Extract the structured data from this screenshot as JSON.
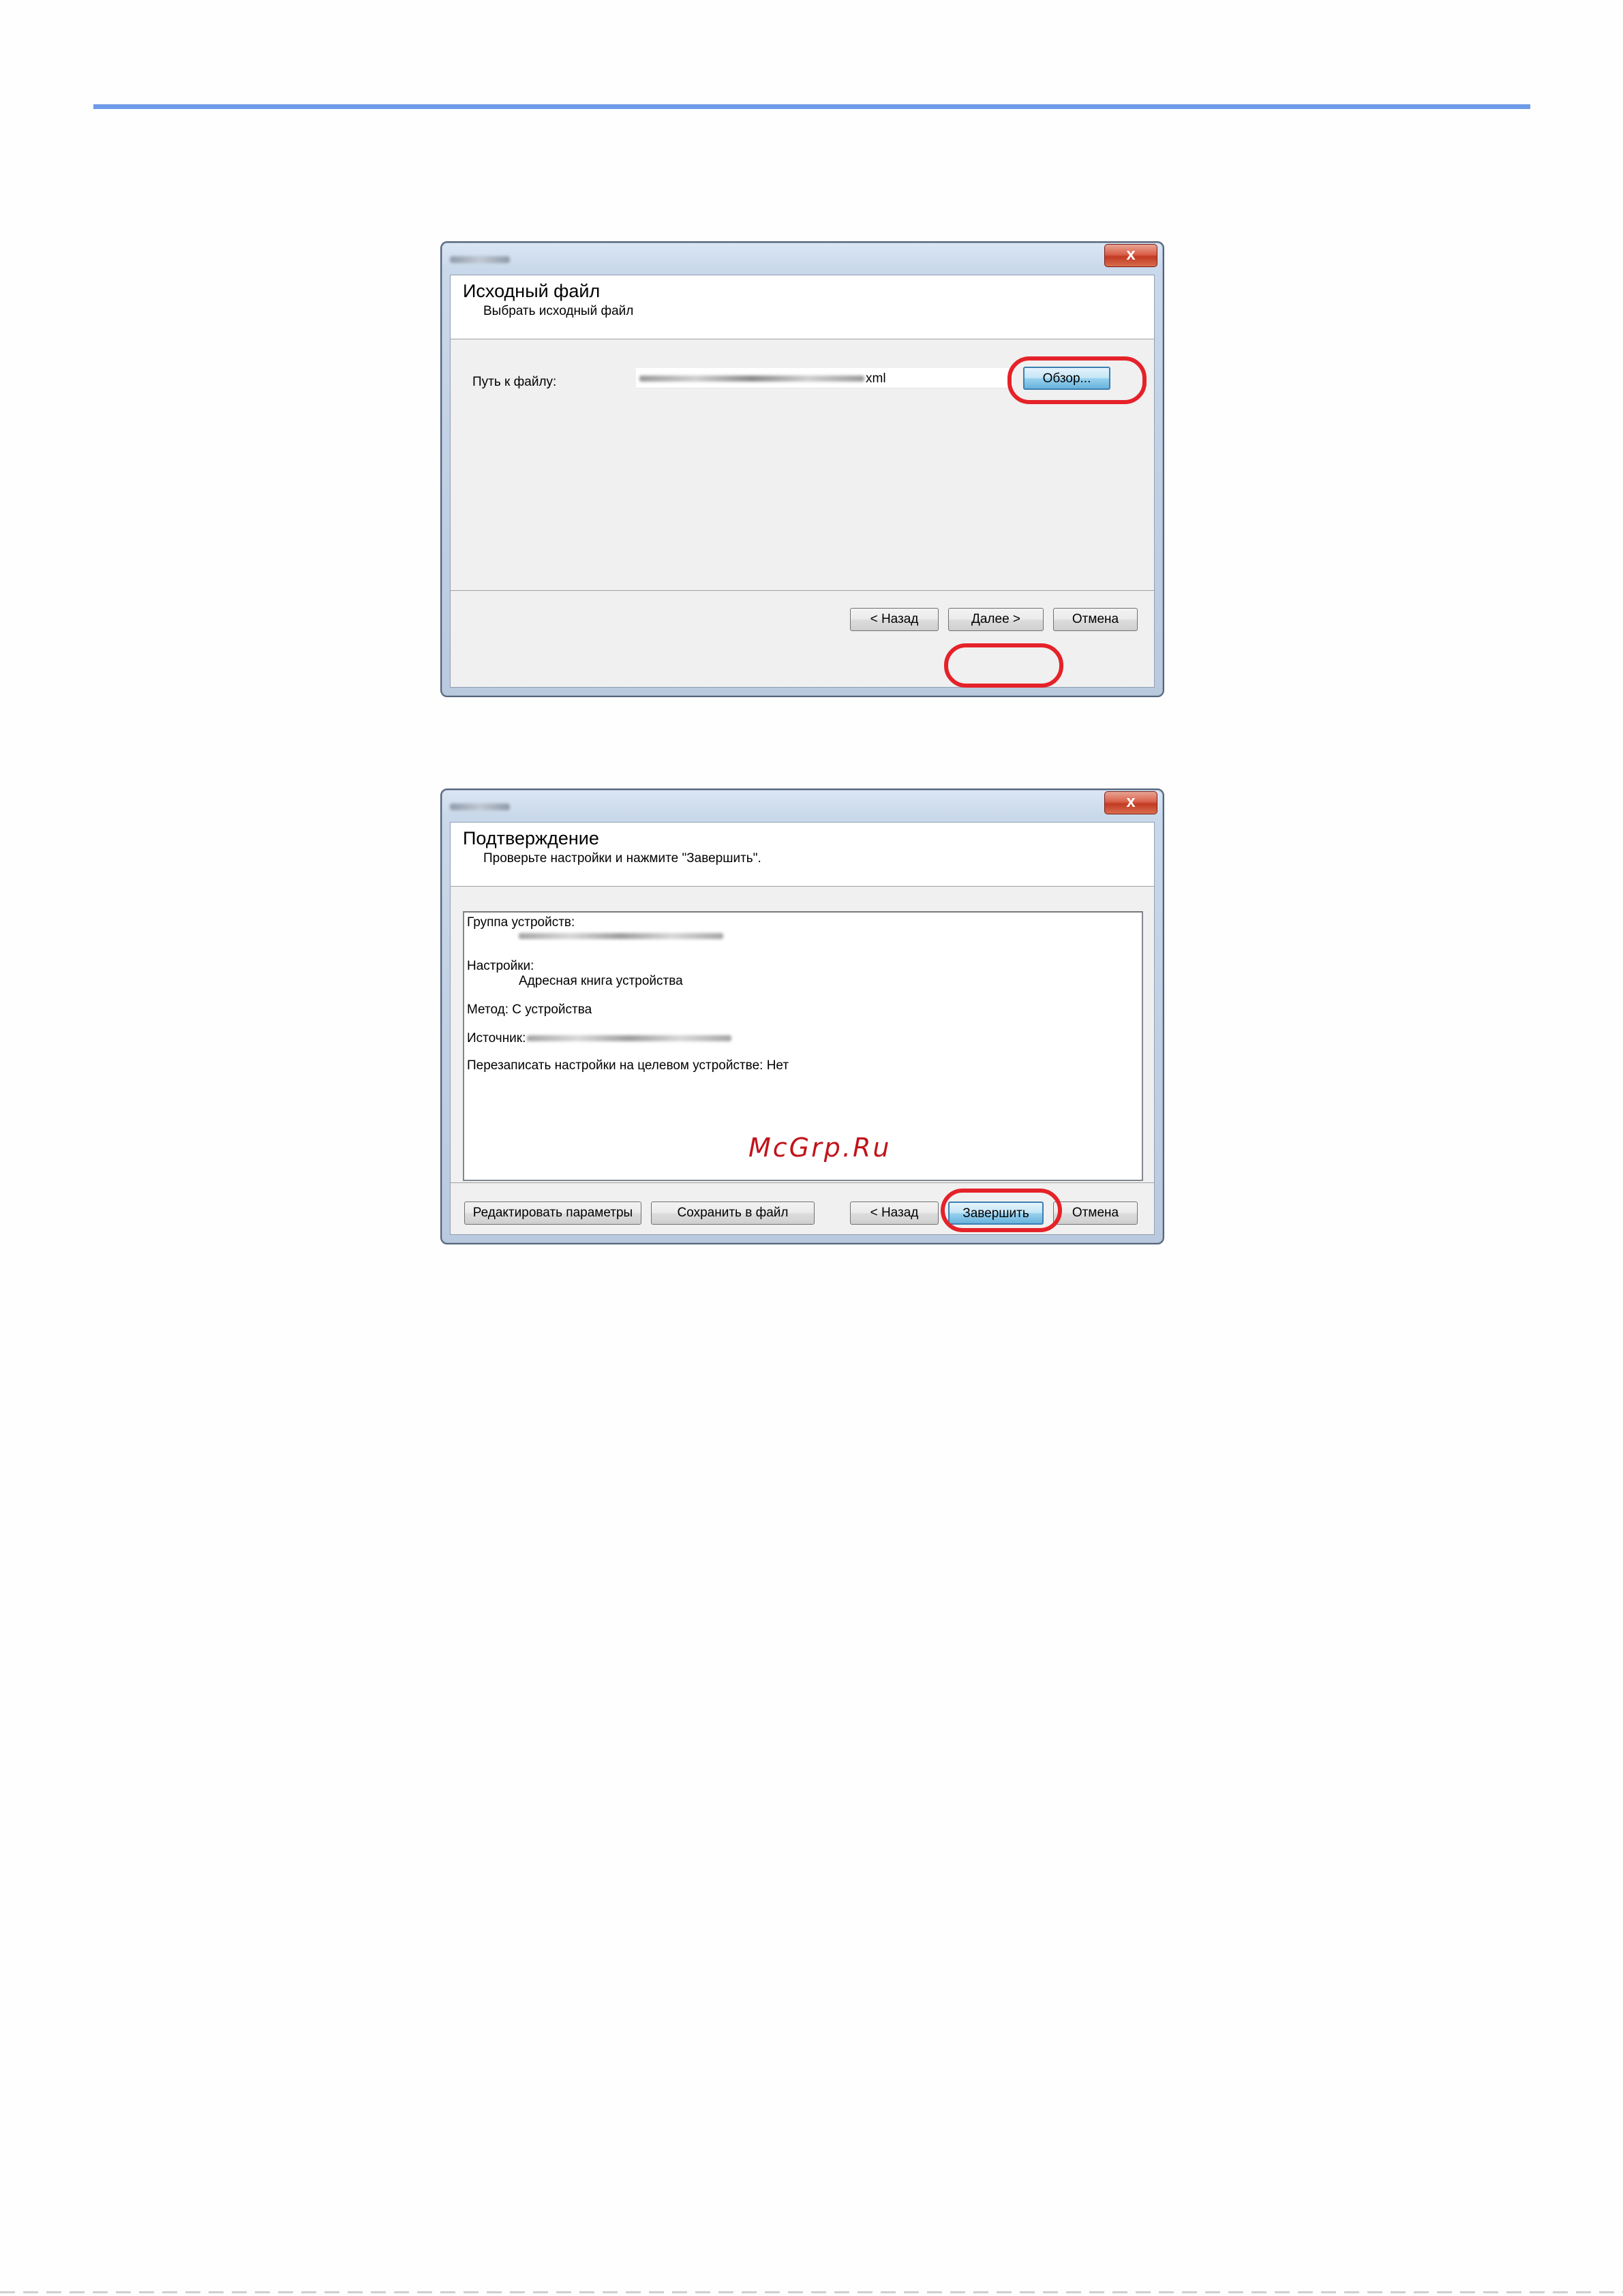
{
  "dialog1": {
    "close_label": "x",
    "header_title": "Исходный файл",
    "header_subtitle": "Выбрать исходный файл",
    "path_label": "Путь к файлу:",
    "path_value_ext": "xml",
    "browse_label": "Обзор...",
    "back_label": "< Назад",
    "next_label": "Далее >",
    "cancel_label": "Отмена"
  },
  "dialog2": {
    "close_label": "x",
    "header_title": "Подтверждение",
    "header_subtitle": "Проверьте настройки и нажмите \"Завершить\".",
    "summary": {
      "group_label": "Группа устройств:",
      "settings_label": "Настройки:",
      "settings_value": "Адресная книга устройства",
      "method_line": "Метод: С устройства",
      "source_label": "Источник:",
      "overwrite_line": "Перезаписать настройки на целевом устройстве: Нет"
    },
    "edit_label": "Редактировать параметры",
    "save_label": "Сохранить в файл",
    "back_label": "< Назад",
    "finish_label": "Завершить",
    "cancel_label": "Отмена"
  },
  "watermark": "McGrp.Ru",
  "colors": {
    "rule": "#6f9be8",
    "highlight_ring": "#e52229",
    "watermark": "#c0141a"
  }
}
